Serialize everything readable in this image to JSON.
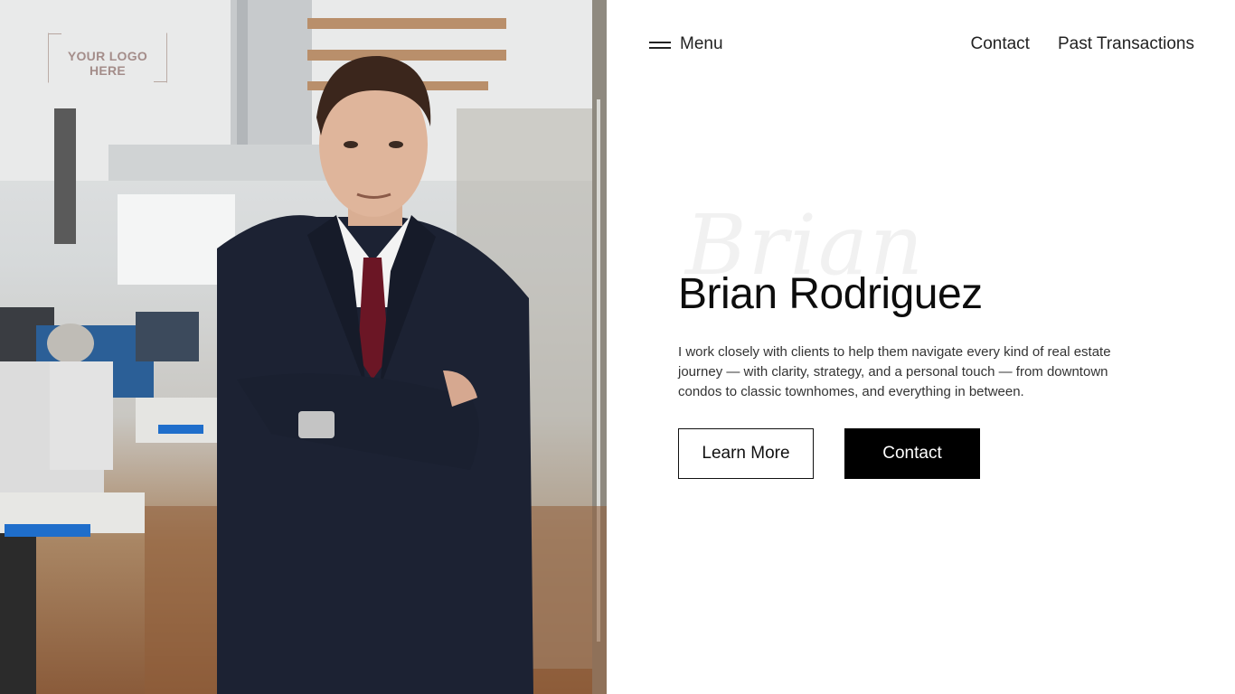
{
  "logo": {
    "text": "YOUR LOGO HERE"
  },
  "nav": {
    "menu_label": "Menu",
    "links": [
      "Contact",
      "Past Transactions"
    ]
  },
  "hero": {
    "script_watermark": "Brian",
    "name": "Brian Rodriguez",
    "description": "I work closely with clients to help them navigate every kind of real estate journey — with clarity, strategy, and a personal touch — from downtown condos to classic townhomes, and everything in between.",
    "buttons": {
      "learn_more": "Learn More",
      "contact": "Contact"
    }
  },
  "colors": {
    "primary_button_bg": "#000000",
    "text": "#111111",
    "background": "#ffffff"
  }
}
